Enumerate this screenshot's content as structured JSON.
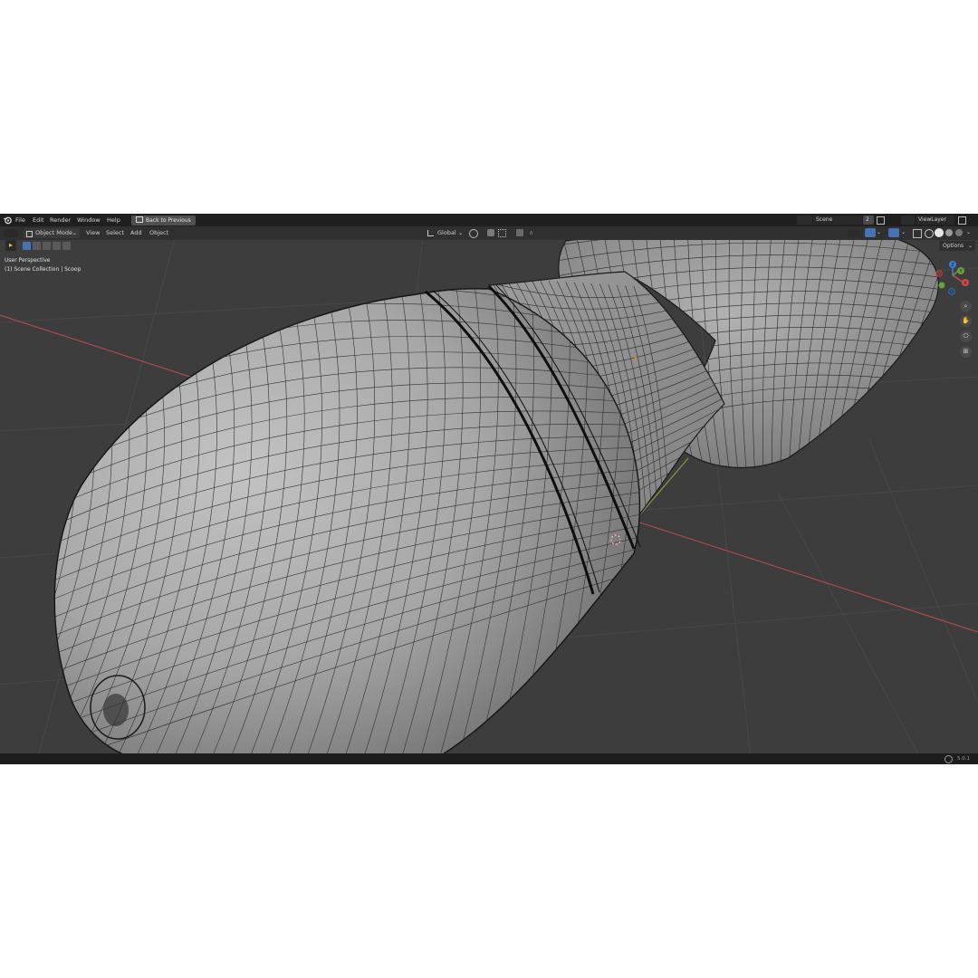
{
  "topbar": {
    "menus": [
      "File",
      "Edit",
      "Render",
      "Window",
      "Help"
    ],
    "back_button": "Back to Previous",
    "scene_label": "Scene",
    "scene_users": "2",
    "view_layer_label": "ViewLayer"
  },
  "header": {
    "mode": "Object Mode",
    "menus": [
      "View",
      "Select",
      "Add",
      "Object"
    ],
    "orientation": "Global",
    "options_label": "Options"
  },
  "viewport": {
    "perspective": "User Perspective",
    "collection": "(1) Scene Collection | Scoop",
    "background": "#3d3d3d",
    "x_axis_color": "#b84a4a",
    "y_axis_color": "#8aa03a",
    "mesh_fill": "#8d8d8d"
  },
  "gizmo": {
    "x_label": "X",
    "y_label": "Y",
    "z_label": "Z"
  },
  "icons": {
    "blender": "blender-logo-icon",
    "editor": "editor-type-icon",
    "zoom": "magnifier-icon",
    "pan": "hand-icon",
    "camera": "camera-icon",
    "ortho": "grid-icon"
  },
  "status": {
    "version": "5.0.1"
  }
}
